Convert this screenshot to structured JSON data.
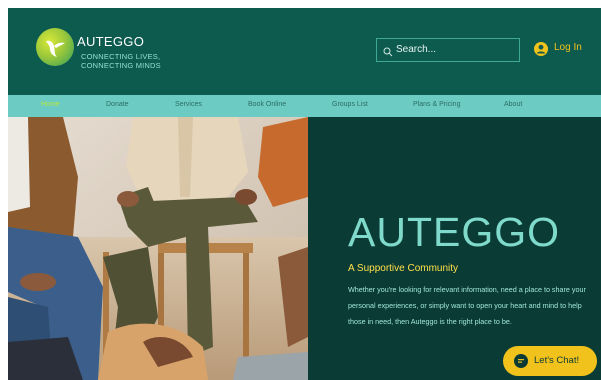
{
  "brand": {
    "name": "AUTEGGO",
    "tagline": "CONNECTING LIVES,\nCONNECTING MINDS",
    "logo_icon": "bird-logo-icon"
  },
  "header": {
    "search_placeholder": "Search...",
    "login_label": "Log In"
  },
  "nav": {
    "items": [
      {
        "label": "Home",
        "active": true
      },
      {
        "label": "Donate"
      },
      {
        "label": "Services"
      },
      {
        "label": "Book Online"
      },
      {
        "label": "Groups List"
      },
      {
        "label": "Plans & Pricing"
      },
      {
        "label": "About"
      }
    ]
  },
  "hero": {
    "title": "AUTEGGO",
    "subtitle": "A Supportive Community",
    "body": "Whether you're looking for relevant information, need a place to share your personal experiences, or simply want to open your heart and mind to help those in need, then Auteggo is the right place to be."
  },
  "chat": {
    "label": "Let's Chat!"
  },
  "colors": {
    "header_bg": "#0d5a4f",
    "nav_bg": "#6ccbc2",
    "hero_bg": "#0b3b35",
    "accent_yellow": "#f1c21b",
    "title_teal": "#7fdacc"
  }
}
